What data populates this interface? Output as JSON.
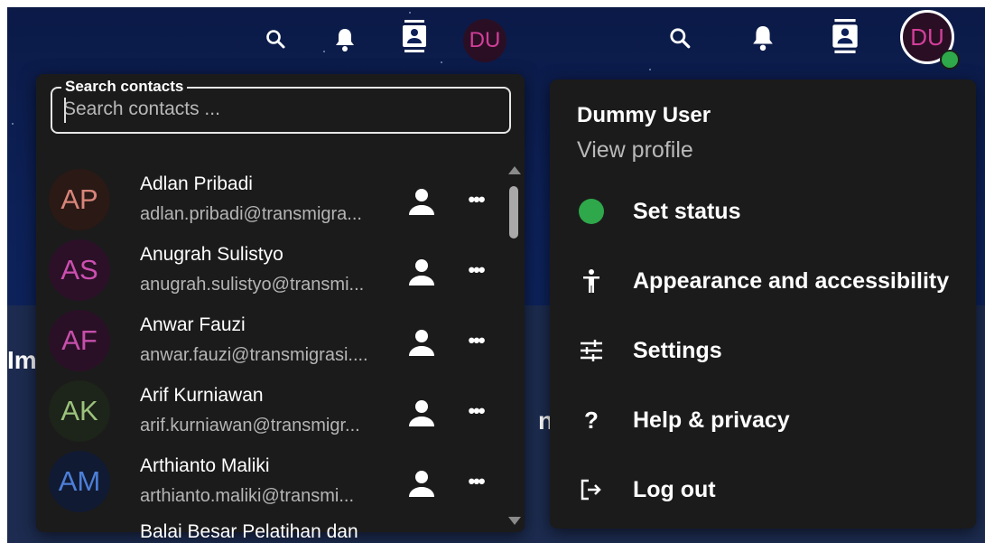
{
  "colors": {
    "header_bg": "#0d2158",
    "dropdown_bg": "#1b1b1b",
    "status_green": "#2ea84a",
    "user_avatar_text": "#d23f9a"
  },
  "header": {
    "search_icon": "search-icon",
    "bell_icon": "bell-icon",
    "contacts_icon": "contacts-icon",
    "user_initials": "DU"
  },
  "contacts": {
    "search_label": "Search contacts",
    "search_placeholder": "Search contacts ...",
    "items": [
      {
        "initials": "AP",
        "name": "Adlan Pribadi",
        "email": "adlan.pribadi@transmigra...",
        "avatar_bg": "#2a1915",
        "avatar_fg": "#d9857a"
      },
      {
        "initials": "AS",
        "name": "Anugrah Sulistyo",
        "email": "anugrah.sulistyo@transmi...",
        "avatar_bg": "#2b1028",
        "avatar_fg": "#cc4fb0"
      },
      {
        "initials": "AF",
        "name": "Anwar Fauzi",
        "email": "anwar.fauzi@transmigrasi....",
        "avatar_bg": "#2a1026",
        "avatar_fg": "#c64fab"
      },
      {
        "initials": "AK",
        "name": "Arif Kurniawan",
        "email": "arif.kurniawan@transmigr...",
        "avatar_bg": "#1d2419",
        "avatar_fg": "#9cc27c"
      },
      {
        "initials": "AM",
        "name": "Arthianto Maliki",
        "email": "arthianto.maliki@transmi...",
        "avatar_bg": "#111a33",
        "avatar_fg": "#4c7fd8"
      }
    ],
    "partial_item": "Balai Besar Pelatihan dan"
  },
  "background": {
    "left_text": "Im",
    "right_text": "n"
  },
  "profile_menu": {
    "name": "Dummy User",
    "view_profile": "View profile",
    "items": [
      {
        "label": "Set status",
        "icon": "status-dot-icon"
      },
      {
        "label": "Appearance and accessibility",
        "icon": "accessibility-icon"
      },
      {
        "label": "Settings",
        "icon": "settings-sliders-icon"
      },
      {
        "label": "Help & privacy",
        "icon": "help-icon"
      },
      {
        "label": "Log out",
        "icon": "logout-icon"
      }
    ]
  }
}
